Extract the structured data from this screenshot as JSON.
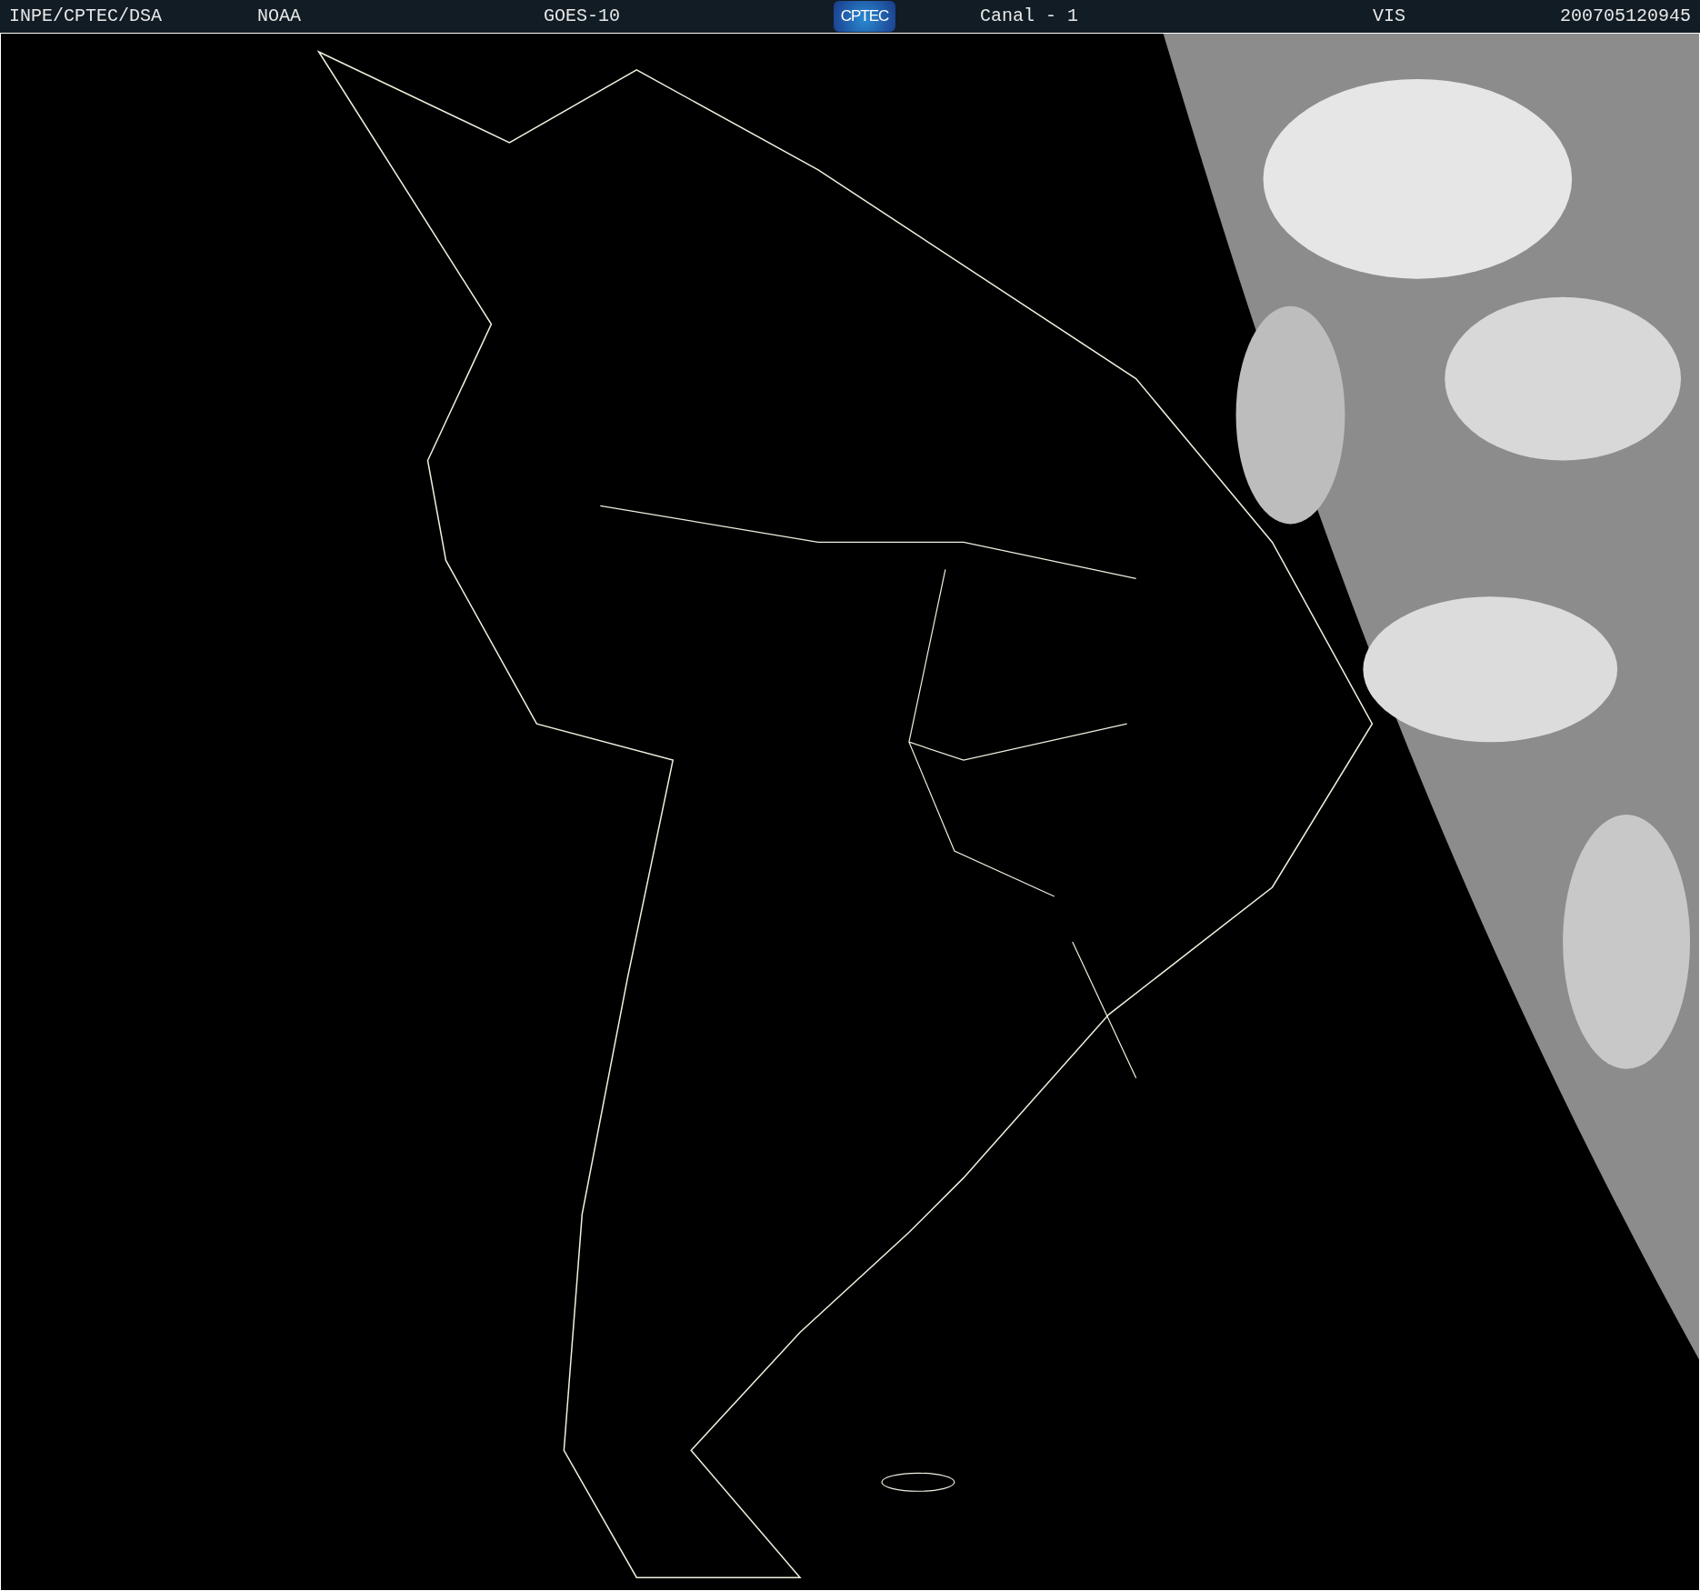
{
  "header": {
    "items": [
      {
        "kind": "text",
        "text": "INPE/CPTEC/DSA"
      },
      {
        "kind": "text",
        "text": "NOAA"
      },
      {
        "kind": "text",
        "text": "GOES-10"
      },
      {
        "kind": "logo",
        "text": "CPTEC"
      },
      {
        "kind": "text",
        "text": "Canal - 1"
      },
      {
        "kind": "text",
        "text": "VIS"
      },
      {
        "kind": "text",
        "text": "200705120945"
      }
    ]
  }
}
